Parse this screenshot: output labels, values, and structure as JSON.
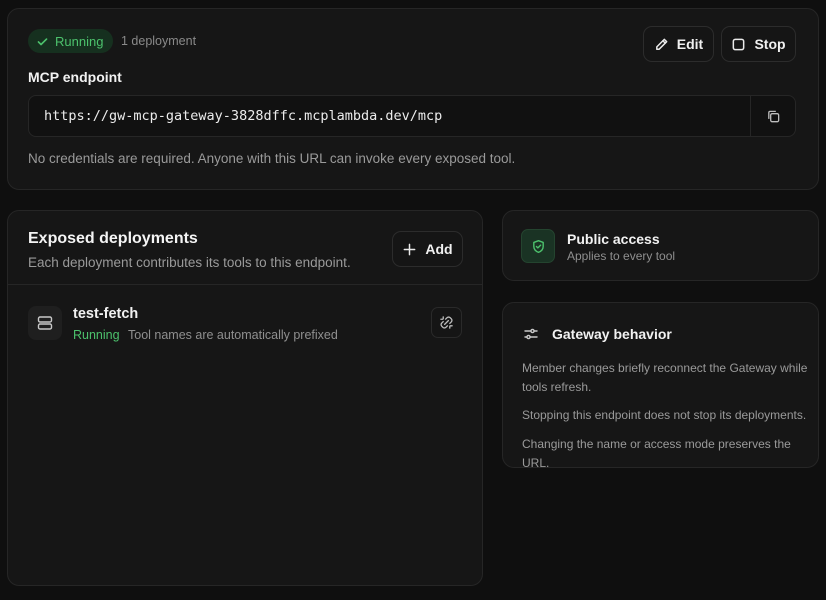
{
  "endpoint_card": {
    "status": "Running",
    "deployment_count": "1 deployment",
    "edit_label": "Edit",
    "stop_label": "Stop",
    "endpoint_label": "MCP endpoint",
    "endpoint_url": "https://gw-mcp-gateway-3828dffc.mcplambda.dev/mcp",
    "note": "No credentials are required. Anyone with this URL can invoke every exposed tool."
  },
  "deployments_card": {
    "title": "Exposed deployments",
    "subtitle": "Each deployment contributes its tools to this endpoint.",
    "add_label": "Add",
    "items": [
      {
        "name": "test-fetch",
        "status": "Running",
        "description": "Tool names are automatically prefixed"
      }
    ]
  },
  "access_card": {
    "title": "Public access",
    "subtitle": "Applies to every tool"
  },
  "behavior_card": {
    "title": "Gateway behavior",
    "lines": [
      "Member changes briefly reconnect the Gateway while tools refresh.",
      "Stopping this endpoint does not stop its deployments.",
      "Changing the name or access mode preserves the URL."
    ]
  },
  "colors": {
    "background": "#0f0f0f",
    "card": "#161616",
    "success": "#4cc16c",
    "success_bg": "#16301f"
  },
  "icons": [
    "check-icon",
    "pencil-icon",
    "square-icon",
    "copy-icon",
    "plus-icon",
    "server-icon",
    "unlink-icon",
    "shield-icon",
    "sliders-icon"
  ]
}
